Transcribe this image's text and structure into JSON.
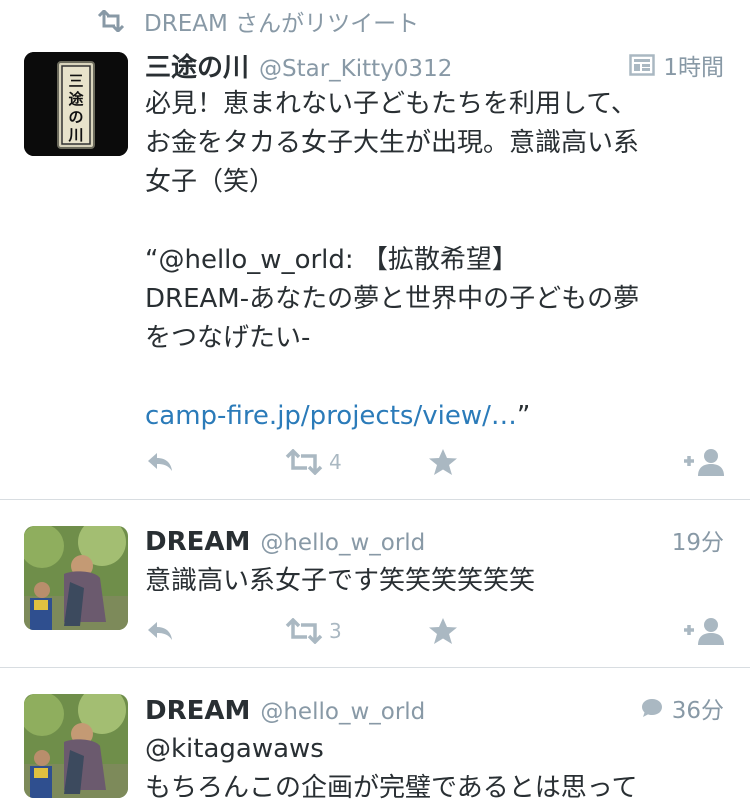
{
  "retweet_context": {
    "text": "DREAM さんがリツイート"
  },
  "tweets": [
    {
      "name": "三途の川",
      "handle": "@Star_Kitty0312",
      "time": "1時間",
      "avatar_text": [
        "三",
        "途",
        "の",
        "川"
      ],
      "body": "必見！恵まれない子どもたちを利用して、\nお金をタカる女子大生が出現。意識高い系\n女子（笑）\n\n“@hello_w_orld: 【拡散希望】\nDREAM-あなたの夢と世界中の子どもの夢\nをつなげたい-\n\n",
      "link": "camp-fire.jp/projects/view/…",
      "link_suffix": "”",
      "retweet_count": "4",
      "meta_icon": "details-icon"
    },
    {
      "name": "DREAM",
      "handle": "@hello_w_orld",
      "time": "19分",
      "body": "意識高い系女子です笑笑笑笑笑笑",
      "retweet_count": "3"
    },
    {
      "name": "DREAM",
      "handle": "@hello_w_orld",
      "time": "36分",
      "body": "@kitagawaws\nもちろんこの企画が完璧であるとは思って",
      "meta_icon": "conversation-icon"
    }
  ],
  "colors": {
    "link": "#2b7bb9",
    "muted": "#8899a6",
    "icon": "#aab8c2",
    "divider": "#d8dde1"
  }
}
